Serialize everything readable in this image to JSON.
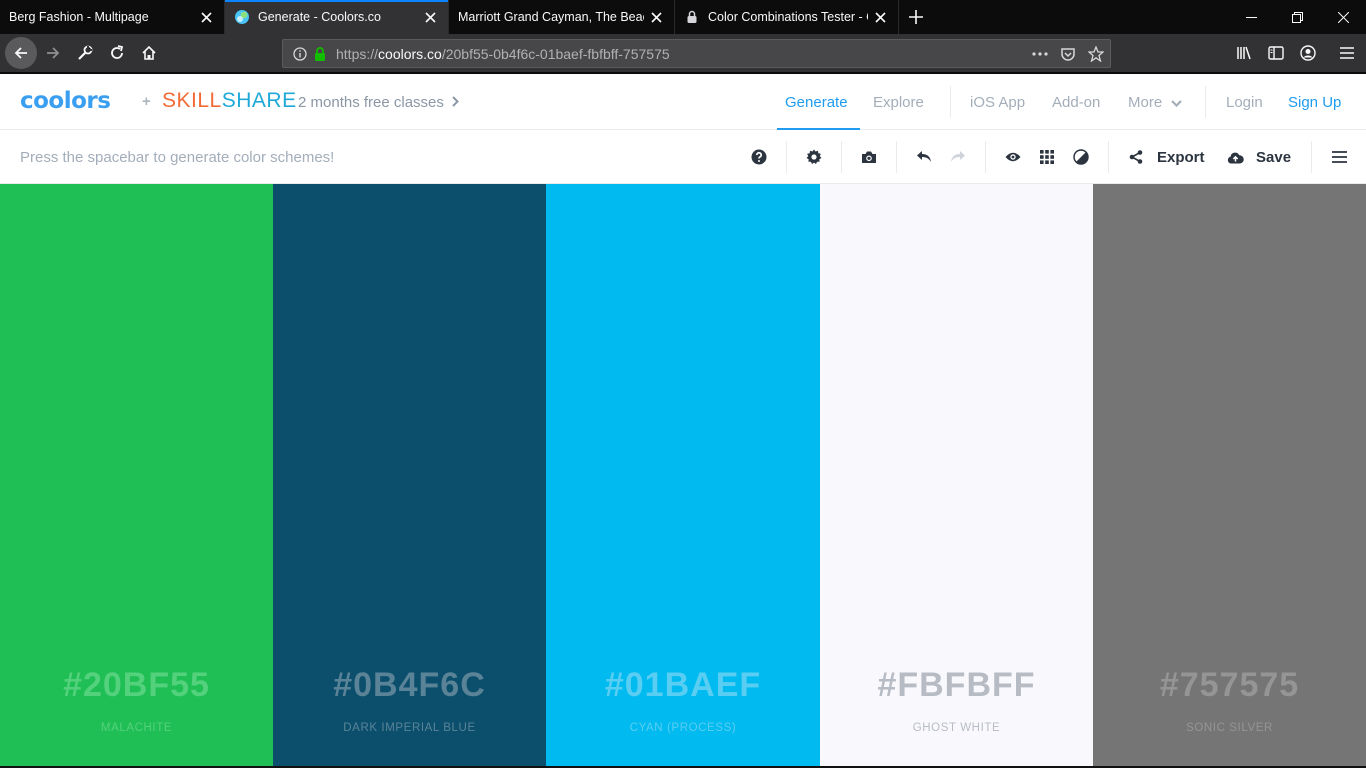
{
  "browser": {
    "tabs": [
      {
        "title": "Berg Fashion - Multipage",
        "favicon": "none"
      },
      {
        "title": "Generate - Coolors.co",
        "favicon": "coolors-icon",
        "active": true
      },
      {
        "title": "Marriott Grand Cayman, The Beach",
        "favicon": "none"
      },
      {
        "title": "Color Combinations Tester - Co",
        "favicon": "lock-icon"
      }
    ],
    "url_prefix": "https://",
    "url_domain": "coolors.co",
    "url_path": "/20bf55-0b4f6c-01baef-fbfbff-757575"
  },
  "header": {
    "logo": "coolors",
    "plus": "+",
    "partner_a": "SKILL",
    "partner_b": "SHARE",
    "promo": "2 months free classes",
    "nav": {
      "generate": "Generate",
      "explore": "Explore",
      "ios": "iOS App",
      "addon": "Add-on",
      "more": "More",
      "login": "Login",
      "signup": "Sign Up"
    }
  },
  "toolbar": {
    "hint": "Press the spacebar to generate color schemes!",
    "export": "Export",
    "save": "Save"
  },
  "palette": [
    {
      "hex": "#20BF55",
      "name": "MALACHITE",
      "bg": "#20bf55",
      "text": "#54d17c"
    },
    {
      "hex": "#0B4F6C",
      "name": "DARK IMPERIAL BLUE",
      "bg": "#0b4f6c",
      "text": "#5b8397"
    },
    {
      "hex": "#01BAEF",
      "name": "CYAN (PROCESS)",
      "bg": "#01baef",
      "text": "#5acef2"
    },
    {
      "hex": "#FBFBFF",
      "name": "GHOST WHITE",
      "bg": "#f9f9fd",
      "text": "#b7bcc4"
    },
    {
      "hex": "#757575",
      "name": "SONIC SILVER",
      "bg": "#757575",
      "text": "#959595"
    }
  ],
  "colors": {
    "accent": "#1f9cf0",
    "logo": "#3a9ff1",
    "skill": "#f26b36",
    "share": "#1fa9d9",
    "firefox_blue": "#0a84ff"
  }
}
